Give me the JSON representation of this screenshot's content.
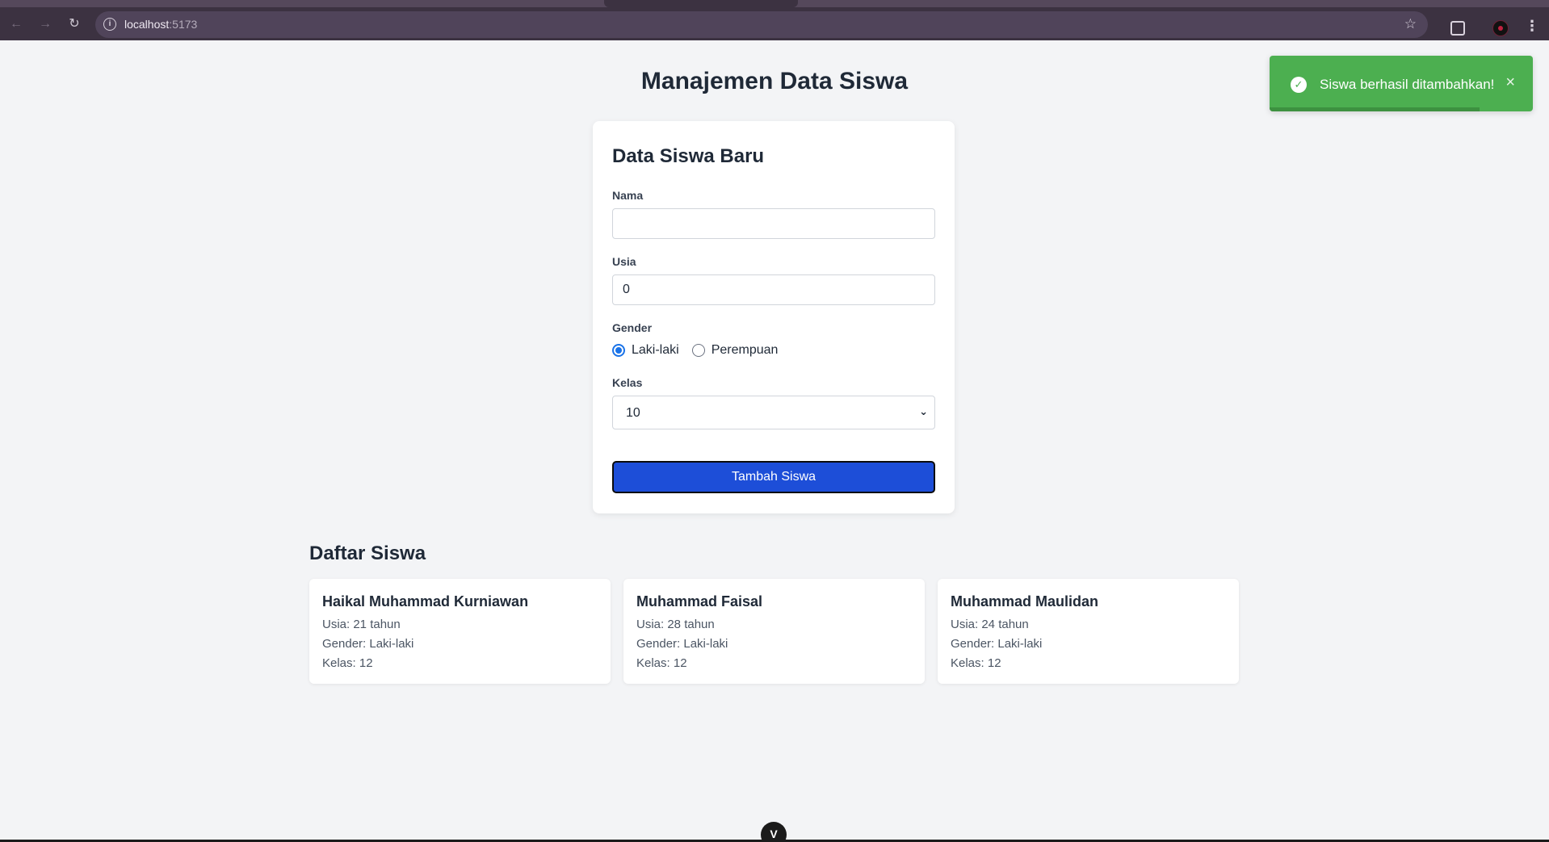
{
  "browser": {
    "url_host": "localhost",
    "url_port": ":5173"
  },
  "page": {
    "title": "Manajemen Data Siswa"
  },
  "form": {
    "title": "Data Siswa Baru",
    "name_label": "Nama",
    "name_value": "",
    "age_label": "Usia",
    "age_value": "0",
    "gender_label": "Gender",
    "gender_options": [
      "Laki-laki",
      "Perempuan"
    ],
    "gender_selected": "Laki-laki",
    "class_label": "Kelas",
    "class_value": "10",
    "submit_label": "Tambah Siswa"
  },
  "list": {
    "title": "Daftar Siswa",
    "students": [
      {
        "name": "Haikal Muhammad Kurniawan",
        "age": "Usia: 21 tahun",
        "gender": "Gender: Laki-laki",
        "class": "Kelas: 12"
      },
      {
        "name": "Muhammad Faisal",
        "age": "Usia: 28 tahun",
        "gender": "Gender: Laki-laki",
        "class": "Kelas: 12"
      },
      {
        "name": "Muhammad Maulidan",
        "age": "Usia: 24 tahun",
        "gender": "Gender: Laki-laki",
        "class": "Kelas: 12"
      }
    ]
  },
  "toast": {
    "message": "Siswa berhasil ditambahkan!",
    "close_glyph": "×"
  },
  "colors": {
    "primary_button": "#1d4ed8",
    "toast_success": "#4caf50",
    "page_background": "#f3f4f6"
  },
  "icons": {
    "back": "arrow-left-icon",
    "forward": "arrow-right-icon",
    "reload": "reload-icon",
    "site_info": "info-icon",
    "bookmark": "star-icon",
    "extensions": "puzzle-icon",
    "menu": "kebab-menu-icon",
    "toast_status": "check-circle-icon",
    "devtools": "vue-devtools-icon"
  }
}
